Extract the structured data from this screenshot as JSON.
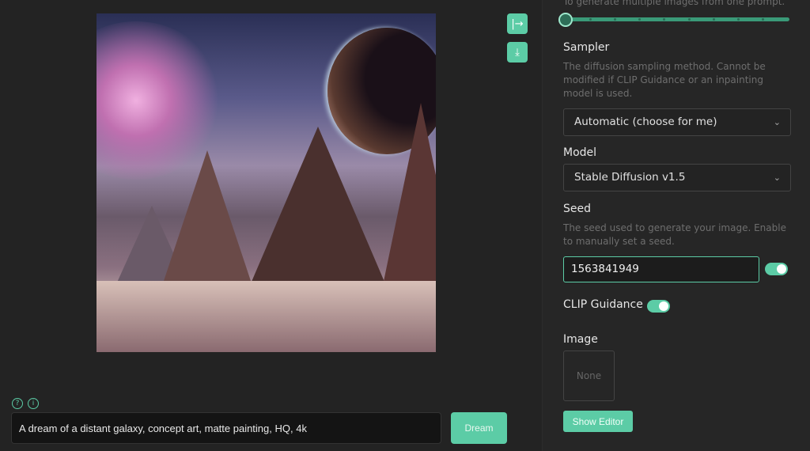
{
  "canvas": {
    "prompt": "A dream of a distant galaxy, concept art, matte painting, HQ, 4k",
    "dream_label": "Dream",
    "help_icons": [
      "question-icon",
      "info-icon"
    ],
    "side_buttons": [
      "expand-arrow-icon",
      "download-icon"
    ]
  },
  "settings": {
    "images_desc": "To generate multiple images from one prompt.",
    "images_slider": {
      "value": 1,
      "min": 1,
      "max": 10
    },
    "sampler": {
      "label": "Sampler",
      "desc": "The diffusion sampling method. Cannot be modified if CLIP Guidance or an inpainting model is used.",
      "value": "Automatic (choose for me)"
    },
    "model": {
      "label": "Model",
      "value": "Stable Diffusion v1.5"
    },
    "seed": {
      "label": "Seed",
      "desc": "The seed used to generate your image. Enable to manually set a seed.",
      "value": "1563841949",
      "enabled": true
    },
    "clip": {
      "label": "CLIP Guidance",
      "enabled": true
    },
    "image": {
      "label": "Image",
      "value": "None",
      "editor_label": "Show Editor"
    }
  },
  "colors": {
    "accent": "#5ccca6",
    "background": "#232323"
  }
}
